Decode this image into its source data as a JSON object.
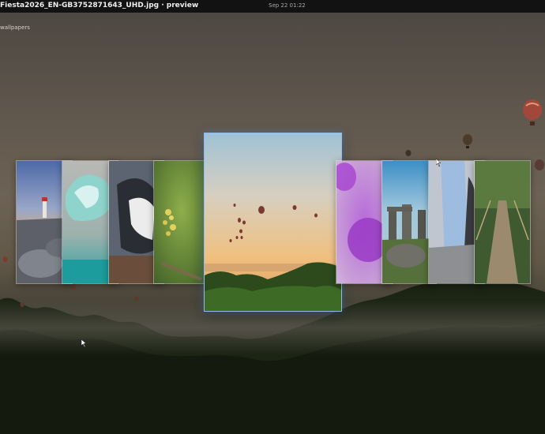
{
  "window": {
    "title": "Fiesta2026_EN-GB3752871643_UHD.jpg · preview",
    "clock": "Sep 22  01:22"
  },
  "folder_label": "wallpapers",
  "icons": {
    "cursor": "mouse-pointer-icon",
    "balloon": "hot-air-balloon-icon"
  },
  "thumbnails": [
    {
      "name": "thumb-lighthouse"
    },
    {
      "name": "thumb-iceberg"
    },
    {
      "name": "thumb-penguin"
    },
    {
      "name": "thumb-yellow-flower"
    },
    {
      "name": "thumb-balloon-fiesta",
      "selected": true
    },
    {
      "name": "thumb-purple-abstract"
    },
    {
      "name": "thumb-stonehenge"
    },
    {
      "name": "thumb-jeans-figure"
    },
    {
      "name": "thumb-rope-bridge"
    }
  ]
}
